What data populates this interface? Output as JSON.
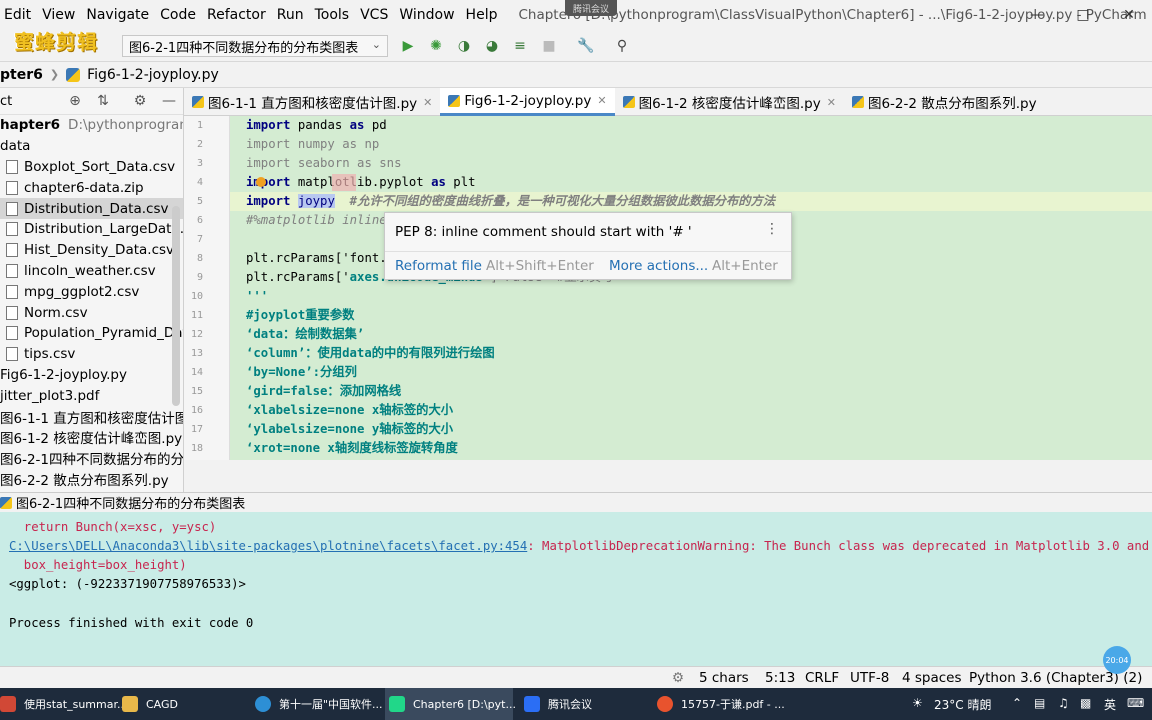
{
  "menubar": {
    "items": [
      "Edit",
      "View",
      "Navigate",
      "Code",
      "Refactor",
      "Run",
      "Tools",
      "VCS",
      "Window",
      "Help"
    ],
    "window_title": "Chapter6 [D:\\pythonprogram\\ClassVisualPython\\Chapter6] - ...\\Fig6-1-2-joyploy.py - PyCharm",
    "meeting_badge": "腾讯会议"
  },
  "toolbar": {
    "watermark": "蜜蜂剪辑",
    "run_config": "图6-2-1四种不同数据分布的分布类图表"
  },
  "breadcrumb": {
    "project": "pter6",
    "file": "Fig6-1-2-joyploy.py"
  },
  "project_panel": {
    "header": "ct",
    "root_name": "hapter6",
    "root_path": "D:\\pythonprogram\\Cl",
    "folder": "data",
    "files": [
      "Boxplot_Sort_Data.csv",
      "chapter6-data.zip",
      "Distribution_Data.csv",
      "Distribution_LargeData.csv",
      "Hist_Density_Data.csv",
      "lincoln_weather.csv",
      "mpg_ggplot2.csv",
      "Norm.csv",
      "Population_Pyramid_Data",
      "tips.csv"
    ],
    "root_files": [
      "Fig6-1-2-joyploy.py",
      "jitter_plot3.pdf",
      "图6-1-1 直方图和核密度估计图",
      "图6-1-2 核密度估计峰峦图.py",
      "图6-2-1四种不同数据分布的分",
      "图6-2-2 散点分布图系列.py"
    ]
  },
  "tabs": [
    {
      "label": "图6-1-1 直方图和核密度估计图.py"
    },
    {
      "label": "Fig6-1-2-joyploy.py"
    },
    {
      "label": "图6-1-2 核密度估计峰峦图.py"
    },
    {
      "label": "图6-2-2 散点分布图系列.py"
    }
  ],
  "editor": {
    "line_numbers": [
      "1",
      "2",
      "3",
      "4",
      "5",
      "6",
      "7",
      "8",
      "9",
      "10",
      "11",
      "12",
      "13",
      "14",
      "15",
      "16",
      "17",
      "18"
    ],
    "lines": {
      "l1_kw1": "import",
      "l1_mod": " pandas ",
      "l1_kw2": "as",
      "l1_alias": " pd",
      "l2": "import numpy as np",
      "l3": "import seaborn as sns",
      "l4_kw1": "import",
      "l4_mod": " matplotlib.pyplot ",
      "l4_kw2": "as",
      "l4_alias": " plt",
      "l5_kw": "import",
      "l5_mod": "joypy",
      "l5_cmt": "  #允许不同组的密度曲线折叠，是一种可视化大量分组数据彼此数据分布的方法",
      "l6": "#%matplotlib inline",
      "l8": "plt.rcParams['font.",
      "l9_a": "plt.rcParams['",
      "l9_b": "axes.unicode_minus",
      "l9_c": "']=False  #显示负号",
      "l10": "'''",
      "l11": "#joyplot重要参数",
      "l12": "‘data：绘制数据集’",
      "l13": "‘column’：使用data的中的有限列进行绘图",
      "l14": "‘by=None’:分组列",
      "l15": "‘gird=false：添加网格线",
      "l16": "‘xlabelsize=none x轴标签的大小",
      "l17": "‘ylabelsize=none y轴标签的大小",
      "l18": "‘xrot=none x轴刻度线标签旋转角度"
    }
  },
  "popup": {
    "message": "PEP 8: inline comment should start with '# '",
    "action1": "Reformat file",
    "shortcut1": "Alt+Shift+Enter",
    "action2": "More actions...",
    "shortcut2": "Alt+Enter"
  },
  "run_panel": {
    "tab_label": "图6-2-1四种不同数据分布的分布类图表",
    "lines": {
      "o1": "  return Bunch(x=xsc, y=ysc)",
      "o2_link": "C:\\Users\\DELL\\Anaconda3\\lib\\site-packages\\plotnine\\facets\\facet.py:454",
      "o2_rest": ": MatplotlibDeprecationWarning: The Bunch class was deprecated in Matplotlib 3.0 and w",
      "o3": "  box_height=box_height)",
      "o4": "<ggplot: (-9223371907758976533)>",
      "o6": "Process finished with exit code 0"
    }
  },
  "statusbar": {
    "chars": "5 chars",
    "position": "5:13",
    "line_sep": "CRLF",
    "encoding": "UTF-8",
    "indent": "4 spaces",
    "interpreter": "Python 3.6 (Chapter3) (2)",
    "clock_badge": "20:04"
  },
  "taskbar": {
    "tasks": [
      "使用stat_summar...",
      "CAGD",
      "第十一届\"中国软件...",
      "Chapter6 [D:\\pyt...",
      "腾讯会议",
      "15757-于谦.pdf - ..."
    ],
    "weather": "23°C 晴朗",
    "ime": "英"
  }
}
